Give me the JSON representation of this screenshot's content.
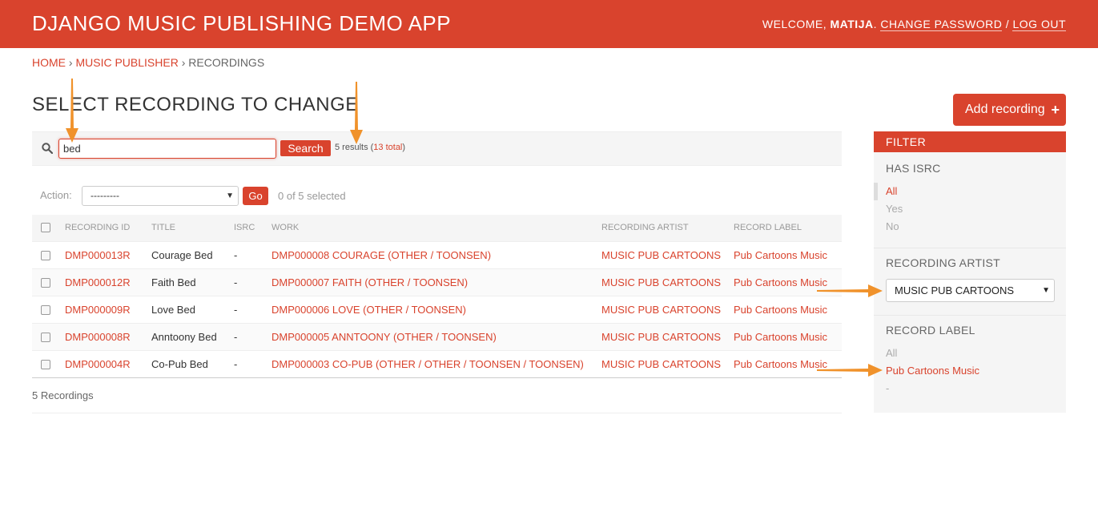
{
  "header": {
    "branding": "DJANGO MUSIC PUBLISHING DEMO APP",
    "welcome_prefix": "WELCOME, ",
    "username": "MATIJA",
    "separator1": ". ",
    "change_password": "CHANGE PASSWORD",
    "separator2": " / ",
    "log_out": "LOG OUT",
    "bg_color": "#d9432d"
  },
  "breadcrumbs": {
    "home": "HOME",
    "sep": " › ",
    "app": "MUSIC PUBLISHER",
    "current": "RECORDINGS"
  },
  "page_title": "SELECT RECORDING TO CHANGE",
  "add_button": {
    "label": "Add recording",
    "icon": "plus-icon",
    "icon_glyph": "+"
  },
  "search": {
    "icon": "search-icon",
    "value": "bed",
    "button_label": "Search",
    "results_prefix": "5 results (",
    "total_link": "13 total",
    "results_suffix": ")"
  },
  "actions": {
    "label": "Action:",
    "selected": "---------",
    "go_label": "Go",
    "counter": "0 of 5 selected"
  },
  "table": {
    "columns": [
      "RECORDING ID",
      "TITLE",
      "ISRC",
      "WORK",
      "RECORDING ARTIST",
      "RECORD LABEL"
    ],
    "rows": [
      {
        "id": "DMP000013R",
        "title": "Courage Bed",
        "isrc": "-",
        "work": "DMP000008 COURAGE (OTHER / TOONSEN)",
        "artist": "MUSIC PUB CARTOONS",
        "label": "Pub Cartoons Music"
      },
      {
        "id": "DMP000012R",
        "title": "Faith Bed",
        "isrc": "-",
        "work": "DMP000007 FAITH (OTHER / TOONSEN)",
        "artist": "MUSIC PUB CARTOONS",
        "label": "Pub Cartoons Music"
      },
      {
        "id": "DMP000009R",
        "title": "Love Bed",
        "isrc": "-",
        "work": "DMP000006 LOVE (OTHER / TOONSEN)",
        "artist": "MUSIC PUB CARTOONS",
        "label": "Pub Cartoons Music"
      },
      {
        "id": "DMP000008R",
        "title": "Anntoony Bed",
        "isrc": "-",
        "work": "DMP000005 ANNTOONY (OTHER / TOONSEN)",
        "artist": "MUSIC PUB CARTOONS",
        "label": "Pub Cartoons Music"
      },
      {
        "id": "DMP000004R",
        "title": "Co-Pub Bed",
        "isrc": "-",
        "work": "DMP000003 CO-PUB (OTHER / OTHER / TOONSEN / TOONSEN)",
        "artist": "MUSIC PUB CARTOONS",
        "label": "Pub Cartoons Music"
      }
    ]
  },
  "paginator": "5 Recordings",
  "filter": {
    "title": "FILTER",
    "has_isrc": {
      "heading": "HAS ISRC",
      "options": [
        "All",
        "Yes",
        "No"
      ],
      "selected": "All"
    },
    "recording_artist": {
      "heading": "RECORDING ARTIST",
      "selected": "MUSIC PUB CARTOONS"
    },
    "record_label": {
      "heading": "RECORD LABEL",
      "options": [
        "All",
        "Pub Cartoons Music",
        "-"
      ],
      "selected": "Pub Cartoons Music"
    }
  },
  "annotation_arrows": {
    "color": "#f0922b"
  }
}
